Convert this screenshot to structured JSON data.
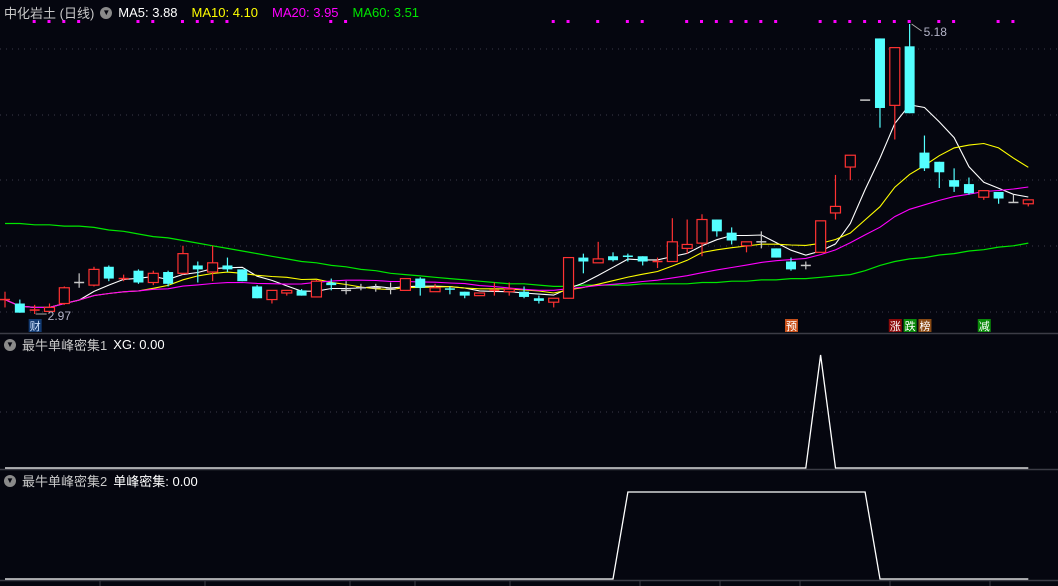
{
  "header": {
    "title": "中化岩土 (日线)",
    "ma": [
      {
        "label": "MA5: 3.88",
        "color": "#ffffff"
      },
      {
        "label": "MA10: 4.10",
        "color": "#ffff00"
      },
      {
        "label": "MA20: 3.95",
        "color": "#ff00ff"
      },
      {
        "label": "MA60: 3.51",
        "color": "#00e600"
      }
    ]
  },
  "chart_data": {
    "type": "candlestick",
    "ylim": [
      2.97,
      5.18
    ],
    "colors": {
      "up": "#ff3232",
      "down": "#54ffff",
      "flat": "#c8c8c8",
      "ma5": "#ffffff",
      "ma10": "#ffff00",
      "ma20": "#ff00ff",
      "ma60": "#00e600",
      "signal": "#ff00ff"
    },
    "ma_periods": [
      5,
      10,
      20
    ],
    "candles_ohlc": [
      [
        3.07,
        3.14,
        3.02,
        3.08
      ],
      [
        3.05,
        3.08,
        2.98,
        2.98
      ],
      [
        2.99,
        3.04,
        2.97,
        3.0
      ],
      [
        2.99,
        3.05,
        2.98,
        3.02
      ],
      [
        3.05,
        3.18,
        3.04,
        3.17
      ],
      [
        3.21,
        3.28,
        3.17,
        3.21
      ],
      [
        3.19,
        3.33,
        3.18,
        3.31
      ],
      [
        3.33,
        3.34,
        3.22,
        3.24
      ],
      [
        3.23,
        3.27,
        3.22,
        3.24
      ],
      [
        3.3,
        3.31,
        3.2,
        3.21
      ],
      [
        3.21,
        3.3,
        3.19,
        3.28
      ],
      [
        3.29,
        3.3,
        3.18,
        3.2
      ],
      [
        3.28,
        3.49,
        3.27,
        3.43
      ],
      [
        3.34,
        3.37,
        3.21,
        3.31
      ],
      [
        3.29,
        3.49,
        3.22,
        3.36
      ],
      [
        3.34,
        3.4,
        3.29,
        3.31
      ],
      [
        3.31,
        3.31,
        3.22,
        3.22
      ],
      [
        3.18,
        3.19,
        3.09,
        3.09
      ],
      [
        3.08,
        3.15,
        3.05,
        3.15
      ],
      [
        3.13,
        3.15,
        3.11,
        3.15
      ],
      [
        3.15,
        3.16,
        3.11,
        3.11
      ],
      [
        3.1,
        3.23,
        3.1,
        3.22
      ],
      [
        3.21,
        3.24,
        3.15,
        3.19
      ],
      [
        3.15,
        3.22,
        3.12,
        3.15
      ],
      [
        3.17,
        3.2,
        3.15,
        3.17
      ],
      [
        3.17,
        3.2,
        3.14,
        3.17
      ],
      [
        3.16,
        3.21,
        3.12,
        3.16
      ],
      [
        3.15,
        3.24,
        3.15,
        3.24
      ],
      [
        3.24,
        3.25,
        3.11,
        3.17
      ],
      [
        3.14,
        3.2,
        3.14,
        3.17
      ],
      [
        3.16,
        3.18,
        3.12,
        3.15
      ],
      [
        3.14,
        3.14,
        3.09,
        3.11
      ],
      [
        3.11,
        3.13,
        3.11,
        3.13
      ],
      [
        3.14,
        3.21,
        3.11,
        3.15
      ],
      [
        3.14,
        3.21,
        3.11,
        3.16
      ],
      [
        3.14,
        3.18,
        3.09,
        3.1
      ],
      [
        3.09,
        3.11,
        3.05,
        3.07
      ],
      [
        3.06,
        3.09,
        3.02,
        3.09
      ],
      [
        3.09,
        3.4,
        3.09,
        3.4
      ],
      [
        3.4,
        3.43,
        3.28,
        3.37
      ],
      [
        3.36,
        3.52,
        3.36,
        3.39
      ],
      [
        3.41,
        3.44,
        3.37,
        3.38
      ],
      [
        3.41,
        3.43,
        3.37,
        3.4
      ],
      [
        3.41,
        3.41,
        3.34,
        3.37
      ],
      [
        3.36,
        3.4,
        3.32,
        3.37
      ],
      [
        3.37,
        3.7,
        3.37,
        3.52
      ],
      [
        3.47,
        3.69,
        3.43,
        3.5
      ],
      [
        3.51,
        3.73,
        3.41,
        3.69
      ],
      [
        3.69,
        3.69,
        3.56,
        3.6
      ],
      [
        3.59,
        3.63,
        3.5,
        3.53
      ],
      [
        3.49,
        3.52,
        3.44,
        3.52
      ],
      [
        3.52,
        3.6,
        3.47,
        3.52
      ],
      [
        3.47,
        3.47,
        3.4,
        3.4
      ],
      [
        3.37,
        3.4,
        3.3,
        3.31
      ],
      [
        3.34,
        3.37,
        3.31,
        3.34
      ],
      [
        3.44,
        3.68,
        3.44,
        3.68
      ],
      [
        3.74,
        4.03,
        3.69,
        3.79
      ],
      [
        4.09,
        4.18,
        3.99,
        4.18
      ],
      [
        4.6,
        4.6,
        4.6,
        4.6
      ],
      [
        5.07,
        5.07,
        4.39,
        4.54
      ],
      [
        4.56,
        5.0,
        4.3,
        5.0
      ],
      [
        5.01,
        5.18,
        4.5,
        4.5
      ],
      [
        4.2,
        4.33,
        4.06,
        4.08
      ],
      [
        4.13,
        4.13,
        3.93,
        4.05
      ],
      [
        3.99,
        4.08,
        3.9,
        3.94
      ],
      [
        3.96,
        4.01,
        3.88,
        3.89
      ],
      [
        3.86,
        3.91,
        3.84,
        3.91
      ],
      [
        3.9,
        3.9,
        3.81,
        3.85
      ],
      [
        3.82,
        3.88,
        3.82,
        3.82
      ],
      [
        3.81,
        3.84,
        3.79,
        3.84
      ]
    ],
    "ma60": [
      3.66,
      3.66,
      3.65,
      3.65,
      3.64,
      3.64,
      3.63,
      3.61,
      3.6,
      3.58,
      3.56,
      3.55,
      3.53,
      3.51,
      3.49,
      3.47,
      3.45,
      3.43,
      3.41,
      3.39,
      3.37,
      3.36,
      3.34,
      3.33,
      3.31,
      3.3,
      3.28,
      3.27,
      3.26,
      3.25,
      3.24,
      3.23,
      3.22,
      3.21,
      3.2,
      3.2,
      3.19,
      3.18,
      3.18,
      3.19,
      3.19,
      3.19,
      3.19,
      3.2,
      3.2,
      3.2,
      3.2,
      3.21,
      3.21,
      3.22,
      3.22,
      3.23,
      3.23,
      3.24,
      3.24,
      3.25,
      3.26,
      3.27,
      3.3,
      3.34,
      3.37,
      3.39,
      3.4,
      3.42,
      3.43,
      3.45,
      3.46,
      3.48,
      3.49,
      3.51
    ],
    "high_label": "5.18",
    "low_label": "2.97",
    "signal_dot_candles": [
      3,
      4,
      5,
      6,
      10,
      11,
      13,
      14,
      15,
      16,
      23,
      24,
      38,
      39,
      41,
      43,
      44,
      47,
      48,
      49,
      50,
      51,
      52,
      53,
      56,
      57,
      58,
      59,
      60,
      61,
      62,
      64,
      65,
      68,
      69
    ],
    "markers": [
      {
        "candle": 3,
        "text": "财",
        "bg": "#123a72",
        "fg": "#cfe3ff"
      },
      {
        "candle": 54,
        "text": "预",
        "bg": "#c8501a",
        "fg": "#ffffff"
      },
      {
        "candle": 61,
        "text": "涨",
        "bg": "#8c0a0a",
        "fg": "#ffffff"
      },
      {
        "candle": 62,
        "text": "跌",
        "bg": "#0a8a0a",
        "fg": "#ffffff"
      },
      {
        "candle": 63,
        "text": "榜",
        "bg": "#8a4a14",
        "fg": "#ffffff"
      },
      {
        "candle": 67,
        "text": "减",
        "bg": "#0a8a0a",
        "fg": "#ffffff"
      }
    ]
  },
  "indicators": [
    {
      "title": "最牛单峰密集1",
      "readout": "XG: 0.00",
      "ylim": [
        0,
        1
      ],
      "active_candles": [
        [
          56,
          56
        ]
      ]
    },
    {
      "title": "最牛单峰密集2",
      "readout": "单峰密集: 0.00",
      "ylim": [
        0,
        1
      ],
      "active_candles": [
        [
          43,
          59
        ]
      ]
    }
  ]
}
